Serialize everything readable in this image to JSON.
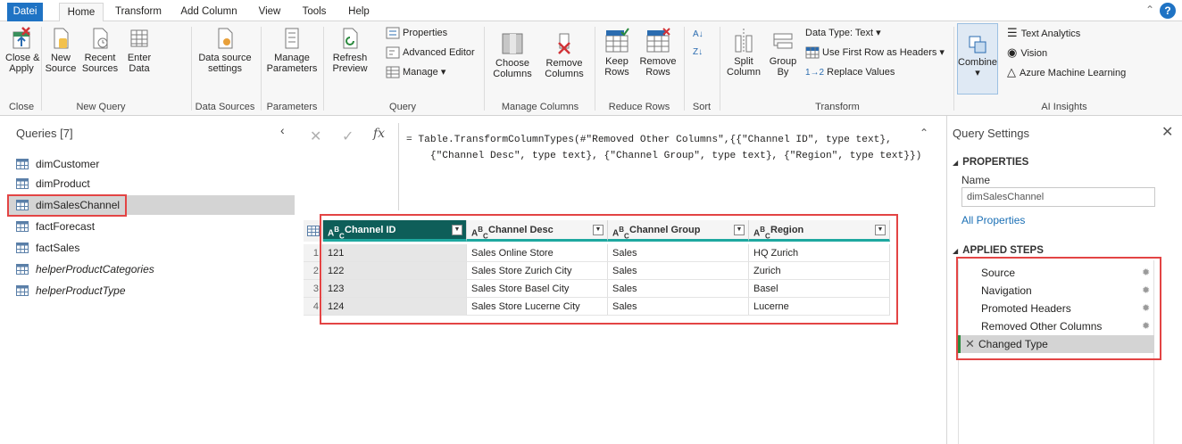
{
  "tabs": [
    "Datei",
    "Home",
    "Transform",
    "Add Column",
    "View",
    "Tools",
    "Help"
  ],
  "ribbon": {
    "close_apply": "Close &\nApply",
    "new_source": "New\nSource",
    "recent_sources": "Recent\nSources",
    "enter_data": "Enter\nData",
    "data_source_settings": "Data source\nsettings",
    "manage_parameters": "Manage\nParameters",
    "refresh_preview": "Refresh\nPreview",
    "properties": "Properties",
    "advanced_editor": "Advanced Editor",
    "manage": "Manage",
    "choose_columns": "Choose\nColumns",
    "remove_columns": "Remove\nColumns",
    "keep_rows": "Keep\nRows",
    "remove_rows": "Remove\nRows",
    "split_column": "Split\nColumn",
    "group_by": "Group\nBy",
    "data_type": "Data Type: Text",
    "first_row_headers": "Use First Row as Headers",
    "replace_values": "Replace Values",
    "combine": "Combine",
    "text_analytics": "Text Analytics",
    "vision": "Vision",
    "azure_ml": "Azure Machine Learning",
    "groups": {
      "close": "Close",
      "new_query": "New Query",
      "data_sources": "Data Sources",
      "parameters": "Parameters",
      "query": "Query",
      "manage_columns": "Manage Columns",
      "reduce_rows": "Reduce Rows",
      "sort": "Sort",
      "transform": "Transform",
      "ai_insights": "AI Insights"
    }
  },
  "queries": {
    "header": "Queries [7]",
    "items": [
      {
        "label": "dimCustomer"
      },
      {
        "label": "dimProduct"
      },
      {
        "label": "dimSalesChannel"
      },
      {
        "label": "factForecast"
      },
      {
        "label": "factSales"
      },
      {
        "label": "helperProductCategories"
      },
      {
        "label": "helperProductType"
      }
    ]
  },
  "formula": {
    "fx": "fx",
    "line1": "= Table.TransformColumnTypes(#\"Removed Other Columns\",{{\"Channel ID\", type text},",
    "line2": "    {\"Channel Desc\", type text}, {\"Channel Group\", type text}, {\"Region\", type text}})"
  },
  "grid": {
    "type_label": "ABC",
    "columns": [
      "Channel ID",
      "Channel Desc",
      "Channel Group",
      "Region"
    ],
    "row_numbers": [
      "1",
      "2",
      "3",
      "4"
    ],
    "rows": [
      [
        "121",
        "Sales Online Store",
        "Sales",
        "HQ Zurich"
      ],
      [
        "122",
        "Sales Store Zurich City",
        "Sales",
        "Zurich"
      ],
      [
        "123",
        "Sales Store Basel City",
        "Sales",
        "Basel"
      ],
      [
        "124",
        "Sales Store Lucerne City",
        "Sales",
        "Lucerne"
      ]
    ]
  },
  "settings": {
    "title": "Query Settings",
    "properties_header": "PROPERTIES",
    "name_label": "Name",
    "name_value": "dimSalesChannel",
    "all_properties": "All Properties",
    "applied_steps_header": "APPLIED STEPS",
    "steps": [
      {
        "label": "Source"
      },
      {
        "label": "Navigation"
      },
      {
        "label": "Promoted Headers"
      },
      {
        "label": "Removed Other Columns"
      },
      {
        "label": "Changed Type"
      }
    ]
  },
  "colors": {
    "accent": "#1f73c4",
    "highlight_red": "#e34444",
    "header_teal": "#0e5e59",
    "header_underline": "#1ea8a0",
    "step_current": "#2b8a3e"
  }
}
